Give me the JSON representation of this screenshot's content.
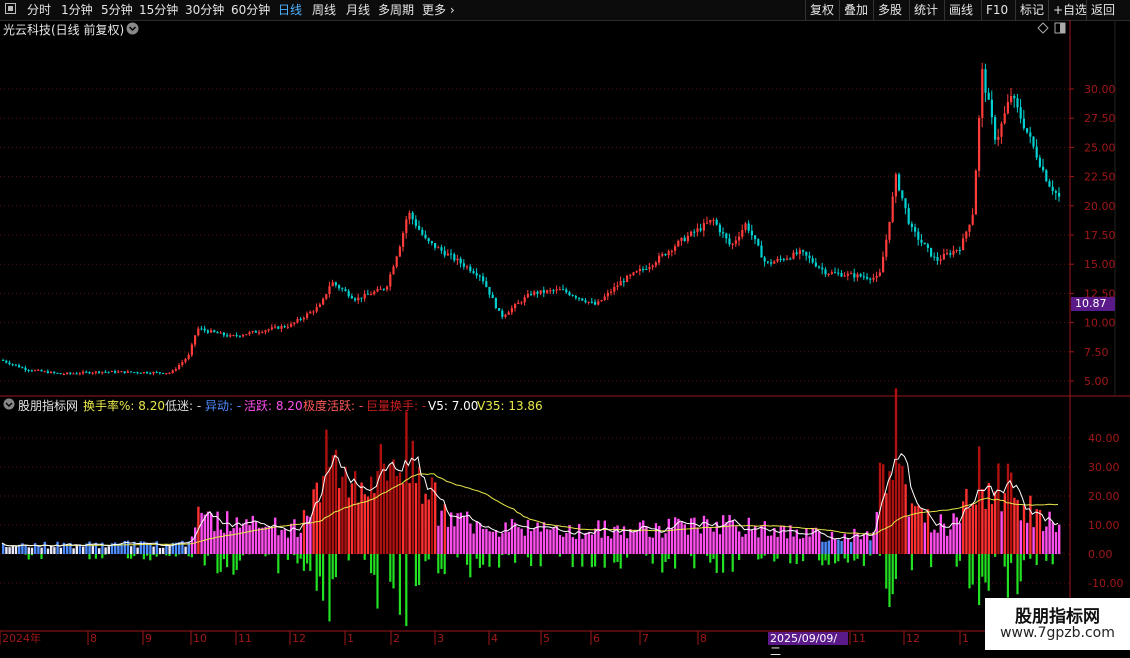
{
  "toolbar": {
    "periods": [
      {
        "label": "分时",
        "active": false
      },
      {
        "label": "1分钟",
        "active": false
      },
      {
        "label": "5分钟",
        "active": false
      },
      {
        "label": "15分钟",
        "active": false
      },
      {
        "label": "30分钟",
        "active": false
      },
      {
        "label": "60分钟",
        "active": false
      },
      {
        "label": "日线",
        "active": true
      },
      {
        "label": "周线",
        "active": false
      },
      {
        "label": "月线",
        "active": false
      },
      {
        "label": "多周期",
        "active": false
      },
      {
        "label": "更多",
        "active": false
      }
    ],
    "right_buttons": [
      "复权",
      "叠加",
      "多股",
      "统计",
      "画线",
      "F10",
      "标记",
      "+自选",
      "返回"
    ]
  },
  "main_panel": {
    "title": "光云科技(日线 前复权)",
    "current_price_tag": "10.87",
    "y_labels": [
      "30.00",
      "27.50",
      "25.00",
      "22.50",
      "20.00",
      "17.50",
      "15.00",
      "12.50",
      "10.00",
      "7.50",
      "5.00"
    ]
  },
  "indicator_panel": {
    "name": "股朋指标网",
    "legend": [
      {
        "label": "换手率%:",
        "value": "8.20",
        "color": "#e8e84a"
      },
      {
        "label": "低迷:",
        "value": "-",
        "color": "#dddddd"
      },
      {
        "label": "异动:",
        "value": "-",
        "color": "#4f8cff"
      },
      {
        "label": "活跃:",
        "value": "8.20",
        "color": "#ff4ff0"
      },
      {
        "label": "极度活跃:",
        "value": "-",
        "color": "#ff5a5a"
      },
      {
        "label": "巨量换手:",
        "value": "-",
        "color": "#c81e1e"
      },
      {
        "label": "V5:",
        "value": "7.00",
        "color": "#ffffff"
      },
      {
        "label": "V35:",
        "value": "13.86",
        "color": "#e8e84a"
      }
    ],
    "y_labels": [
      "40.00",
      "30.00",
      "20.00",
      "10.00",
      "0.00",
      "-10.00"
    ]
  },
  "x_axis": {
    "labels": [
      "2024年",
      "8",
      "9",
      "10",
      "11",
      "12",
      "1",
      "2",
      "3",
      "4",
      "5",
      "6",
      "7",
      "8",
      "11",
      "12",
      "1"
    ],
    "cursor_date": "2025/09/09/二"
  },
  "watermark": {
    "title": "股朋指标网",
    "url": "www.7gpzb.com"
  },
  "colors": {
    "up": "#ff3c3c",
    "down": "#00d0d0",
    "grid": "#5a1010",
    "axis": "#a01818"
  }
}
